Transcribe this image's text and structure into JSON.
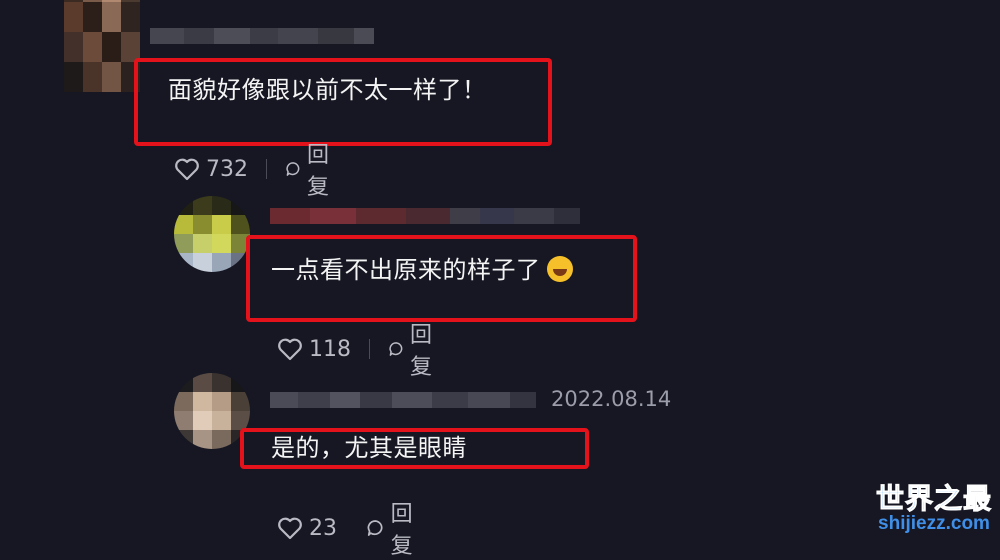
{
  "comments": [
    {
      "text": "面貌好像跟以前不太一样了！",
      "likes": "732",
      "reply_label": "回复",
      "date": ""
    },
    {
      "text": "一点看不出原来的样子了",
      "emoji_icon": "laughing-tears-emoji",
      "likes": "118",
      "reply_label": "回复",
      "date": ""
    },
    {
      "text": "是的，尤其是眼睛",
      "likes": "23",
      "reply_label": "回复",
      "date": "2022.08.14"
    }
  ],
  "watermark": {
    "title": "世界之最",
    "domain": "shijiezz.com"
  },
  "colors": {
    "background": "#161722",
    "highlight_border": "#e3121b",
    "action_text": "#b9bac3",
    "watermark": "#4aa5ff"
  }
}
